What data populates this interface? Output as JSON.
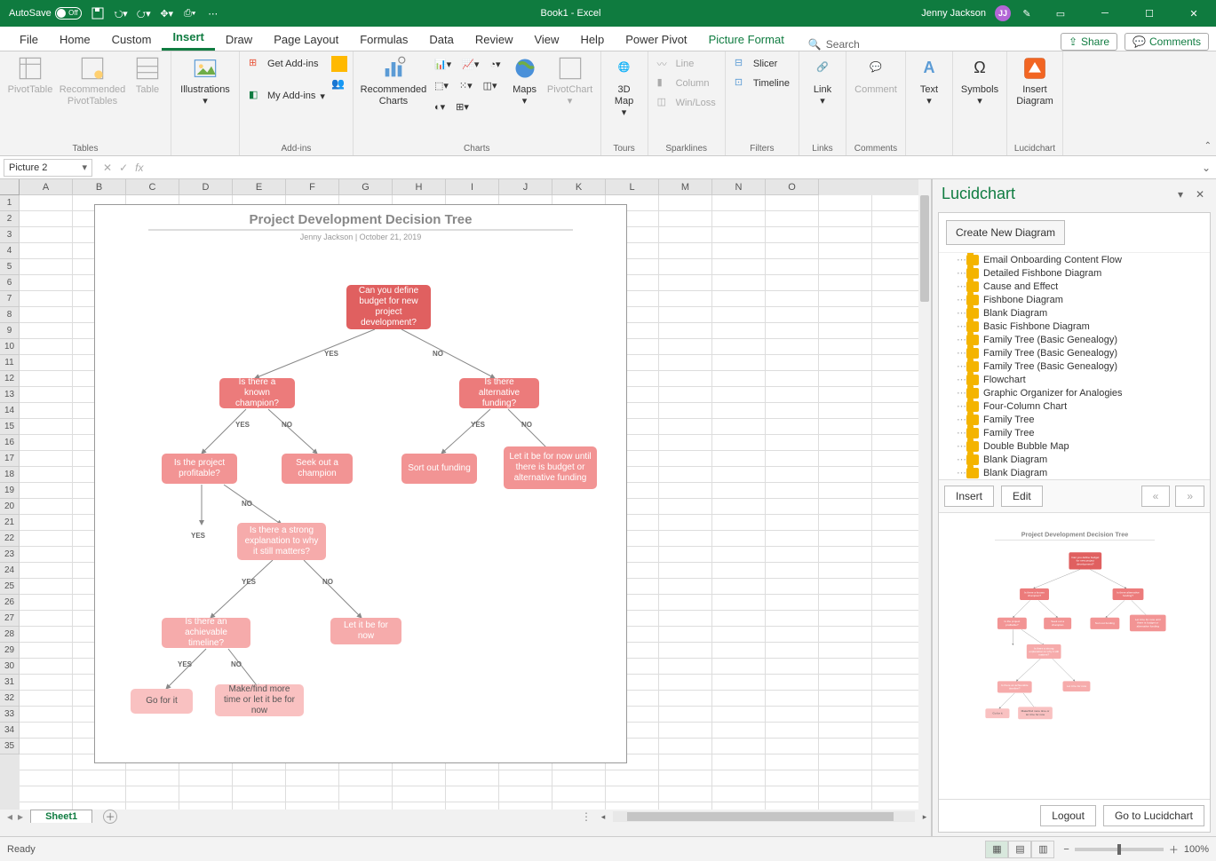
{
  "titlebar": {
    "autosave_label": "AutoSave",
    "title": "Book1 - Excel",
    "user": "Jenny Jackson",
    "initials": "JJ"
  },
  "tabs": {
    "items": [
      "File",
      "Home",
      "Custom",
      "Insert",
      "Draw",
      "Page Layout",
      "Formulas",
      "Data",
      "Review",
      "View",
      "Help",
      "Power Pivot",
      "Picture Format"
    ],
    "active": "Insert",
    "search": "Search",
    "share": "Share",
    "comments": "Comments"
  },
  "ribbon": {
    "groups": {
      "tables": {
        "label": "Tables",
        "pivot": "PivotTable",
        "recpiv": "Recommended PivotTables",
        "table": "Table"
      },
      "illus": {
        "label": "Illustrations",
        "btn": "Illustrations"
      },
      "addins": {
        "label": "Add-ins",
        "get": "Get Add-ins",
        "my": "My Add-ins"
      },
      "charts": {
        "label": "Charts",
        "rec": "Recommended Charts",
        "maps": "Maps",
        "pivotchart": "PivotChart"
      },
      "tours": {
        "label": "Tours",
        "map3d": "3D Map"
      },
      "spark": {
        "label": "Sparklines",
        "line": "Line",
        "col": "Column",
        "wl": "Win/Loss"
      },
      "filters": {
        "label": "Filters",
        "slicer": "Slicer",
        "timeline": "Timeline"
      },
      "links": {
        "label": "Links",
        "link": "Link"
      },
      "comments": {
        "label": "Comments",
        "comment": "Comment"
      },
      "text": {
        "label": "Text",
        "btn": "Text"
      },
      "symbols": {
        "label": "Symbols",
        "btn": "Symbols"
      },
      "lucid": {
        "label": "Lucidchart",
        "btn": "Insert Diagram"
      }
    }
  },
  "formula": {
    "namebox": "Picture 2"
  },
  "columns": [
    "A",
    "B",
    "C",
    "D",
    "E",
    "F",
    "G",
    "H",
    "I",
    "J",
    "K",
    "L",
    "M",
    "N",
    "O"
  ],
  "rows": 35,
  "flowchart": {
    "title": "Project Development Decision Tree",
    "sub": "Jenny Jackson  |  October 21, 2019",
    "nodes": {
      "q1": "Can you define budget for new project development?",
      "q2": "Is there a known champion?",
      "q3": "Is there alternative funding?",
      "q4": "Is the project profitable?",
      "a1": "Seek out a champion",
      "a2": "Sort out funding",
      "a3": "Let it be for now until there is budget or alternative funding",
      "q5": "Is there a strong explanation to why it still matters?",
      "q6": "Is there an achievable timeline?",
      "a4": "Let it be for now",
      "a5": "Go for it",
      "a6": "Make/find more time or let it be for now"
    },
    "edges": {
      "yes": "YES",
      "no": "NO"
    }
  },
  "pane": {
    "title": "Lucidchart",
    "create": "Create New Diagram",
    "items": [
      "Email Onboarding Content Flow",
      "Detailed Fishbone Diagram",
      "Cause and Effect",
      "Fishbone Diagram",
      "Blank Diagram",
      "Basic Fishbone Diagram",
      "Family Tree (Basic Genealogy)",
      "Family Tree (Basic Genealogy)",
      "Family Tree (Basic Genealogy)",
      "Flowchart",
      "Graphic Organizer for Analogies",
      "Four-Column Chart",
      "Family Tree",
      "Family Tree",
      "Double Bubble Map",
      "Blank Diagram",
      "Blank Diagram"
    ],
    "insert": "Insert",
    "edit": "Edit",
    "prev": "«",
    "next": "»",
    "logout": "Logout",
    "goto": "Go to Lucidchart",
    "preview_title": "Project Development Decision Tree"
  },
  "status": {
    "ready": "Ready",
    "zoom": "100%"
  },
  "sheet": {
    "tab": "Sheet1"
  }
}
